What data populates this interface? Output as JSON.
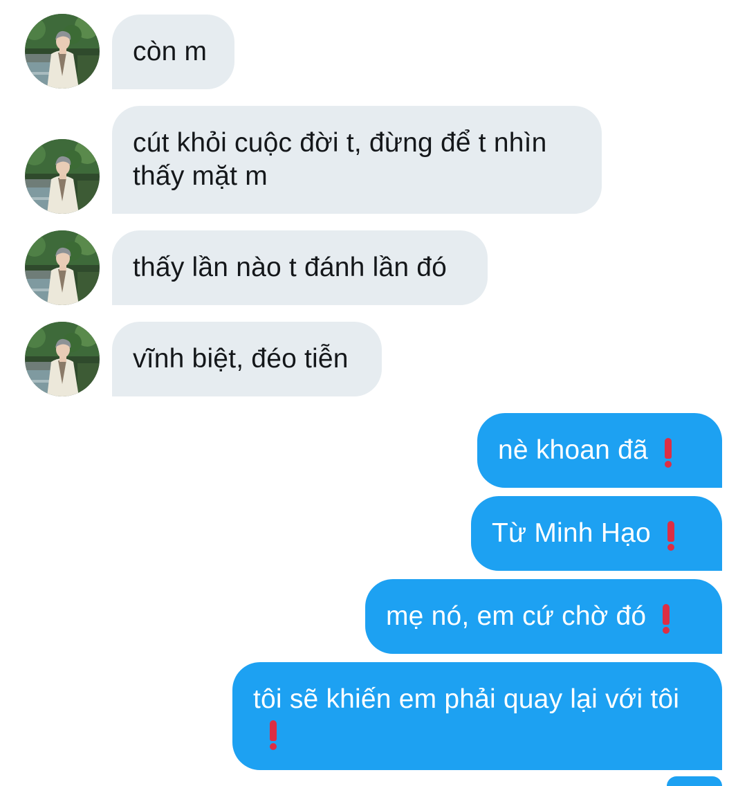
{
  "conversation": {
    "incoming": [
      {
        "text": "còn m",
        "avatar_icon": "profile-photo-icon"
      },
      {
        "text": "cút khỏi cuộc đời t, đừng để t nhìn thấy mặt m",
        "avatar_icon": "profile-photo-icon"
      },
      {
        "text": "thấy lần nào t đánh lần đó",
        "avatar_icon": "profile-photo-icon"
      },
      {
        "text": "vĩnh biệt, đéo tiễn",
        "avatar_icon": "profile-photo-icon"
      }
    ],
    "outgoing": [
      {
        "text": "nè khoan đã",
        "emoji_icon": "red-exclamation-icon"
      },
      {
        "text": "Từ Minh Hạo",
        "emoji_icon": "red-exclamation-icon"
      },
      {
        "text": "mẹ nó, em cứ chờ đó",
        "emoji_icon": "red-exclamation-icon"
      },
      {
        "text": "tôi sẽ khiến em phải quay lại với tôi",
        "emoji_icon": "red-exclamation-icon"
      }
    ]
  },
  "colors": {
    "incoming_bubble": "#e6ecf0",
    "incoming_text": "#14171a",
    "outgoing_bubble": "#1da1f2",
    "outgoing_text": "#ffffff",
    "emoji_red": "#dd2e44"
  }
}
